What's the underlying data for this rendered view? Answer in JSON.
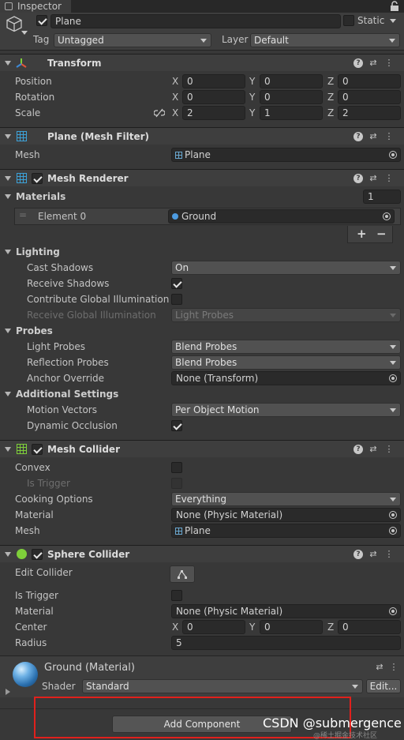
{
  "tab": {
    "label": "Inspector"
  },
  "object": {
    "name": "Plane",
    "static_label": "Static",
    "tag_label": "Tag",
    "tag_value": "Untagged",
    "layer_label": "Layer",
    "layer_value": "Default"
  },
  "transform": {
    "title": "Transform",
    "rows": [
      {
        "label": "Position",
        "x": "0",
        "y": "0",
        "z": "0"
      },
      {
        "label": "Rotation",
        "x": "0",
        "y": "0",
        "z": "0"
      },
      {
        "label": "Scale",
        "x": "2",
        "y": "1",
        "z": "2"
      }
    ],
    "axis": {
      "x": "X",
      "y": "Y",
      "z": "Z"
    }
  },
  "mesh_filter": {
    "title": "Plane (Mesh Filter)",
    "mesh_label": "Mesh",
    "mesh_value": "Plane"
  },
  "mesh_renderer": {
    "title": "Mesh Renderer",
    "materials_label": "Materials",
    "materials_count": "1",
    "element_label": "Element 0",
    "element_value": "Ground",
    "add_label": "+",
    "remove_label": "−",
    "lighting_label": "Lighting",
    "cast_shadows_label": "Cast Shadows",
    "cast_shadows_value": "On",
    "receive_shadows_label": "Receive Shadows",
    "contribute_gi_label": "Contribute Global Illumination",
    "receive_gi_label": "Receive Global Illumination",
    "receive_gi_value": "Light Probes",
    "probes_label": "Probes",
    "light_probes_label": "Light Probes",
    "light_probes_value": "Blend Probes",
    "reflection_probes_label": "Reflection Probes",
    "reflection_probes_value": "Blend Probes",
    "anchor_override_label": "Anchor Override",
    "anchor_override_value": "None (Transform)",
    "additional_label": "Additional Settings",
    "motion_vectors_label": "Motion Vectors",
    "motion_vectors_value": "Per Object Motion",
    "dynamic_occlusion_label": "Dynamic Occlusion"
  },
  "mesh_collider": {
    "title": "Mesh Collider",
    "convex_label": "Convex",
    "is_trigger_label": "Is Trigger",
    "cooking_label": "Cooking Options",
    "cooking_value": "Everything",
    "material_label": "Material",
    "material_value": "None (Physic Material)",
    "mesh_label": "Mesh",
    "mesh_value": "Plane"
  },
  "sphere_collider": {
    "title": "Sphere Collider",
    "edit_label": "Edit Collider",
    "is_trigger_label": "Is Trigger",
    "material_label": "Material",
    "material_value": "None (Physic Material)",
    "center_label": "Center",
    "center_x": "0",
    "center_y": "0",
    "center_z": "0",
    "radius_label": "Radius",
    "radius_value": "5"
  },
  "material": {
    "title": "Ground (Material)",
    "shader_label": "Shader",
    "shader_value": "Standard",
    "edit_label": "Edit..."
  },
  "add_component_label": "Add Component",
  "watermark": "CSDN @submergence",
  "watermark_sub": "@稀土掘金技术社区",
  "colors": {
    "highlight_box": "#e0201c",
    "background": "#383838",
    "header": "#3e3e3e"
  }
}
